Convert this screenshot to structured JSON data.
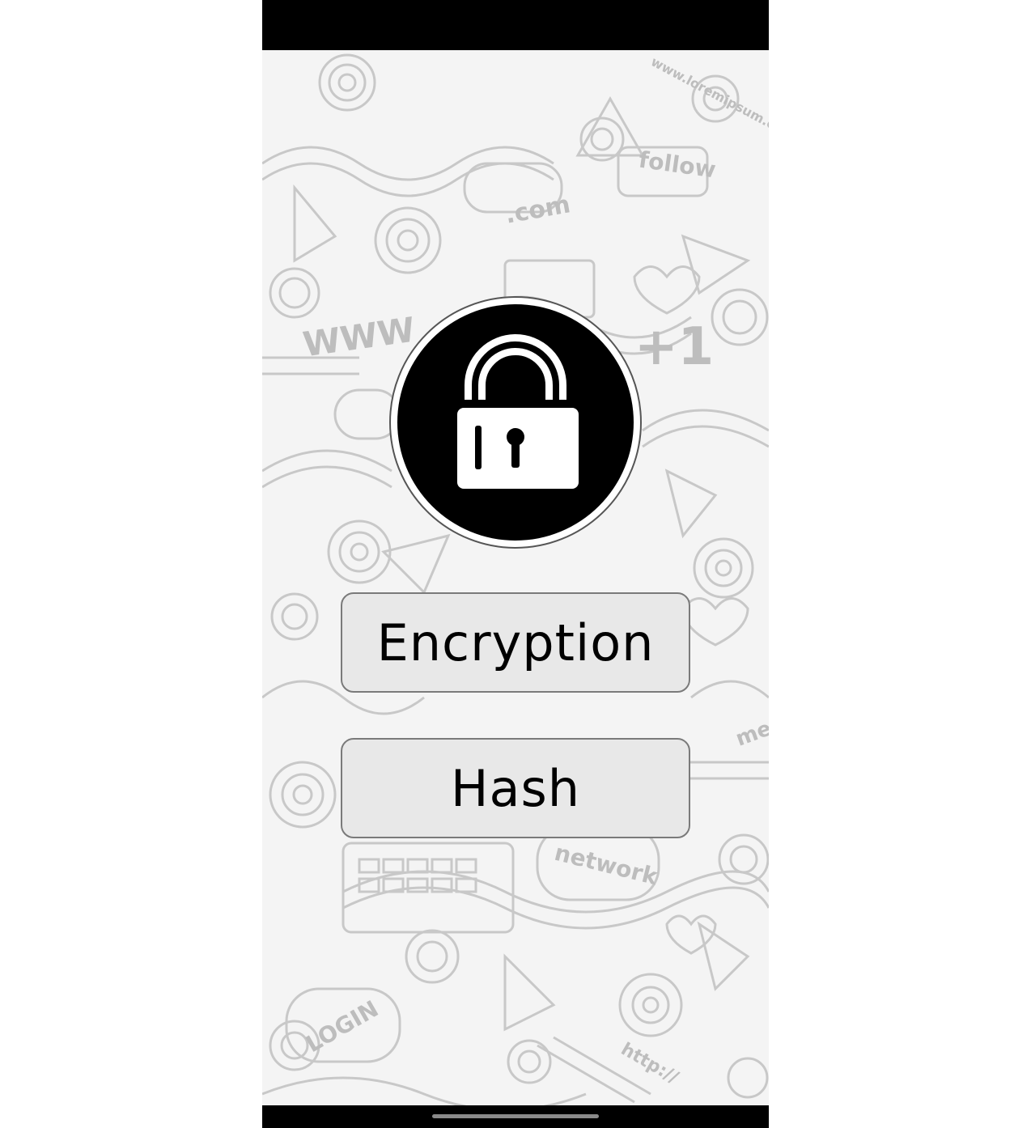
{
  "app": {
    "logo_icon": "padlock-open-icon",
    "buttons": {
      "encryption_label": "Encryption",
      "hash_label": "Hash"
    },
    "background": {
      "doodle_words": [
        "follow",
        ".com",
        "WWW",
        "+1",
        "network",
        "LOGIN",
        "www.loremipsum.com",
        "http://",
        "me"
      ]
    },
    "colors": {
      "button_bg": "#e8e8e8",
      "logo_bg": "#000000",
      "bars": "#000000"
    }
  }
}
